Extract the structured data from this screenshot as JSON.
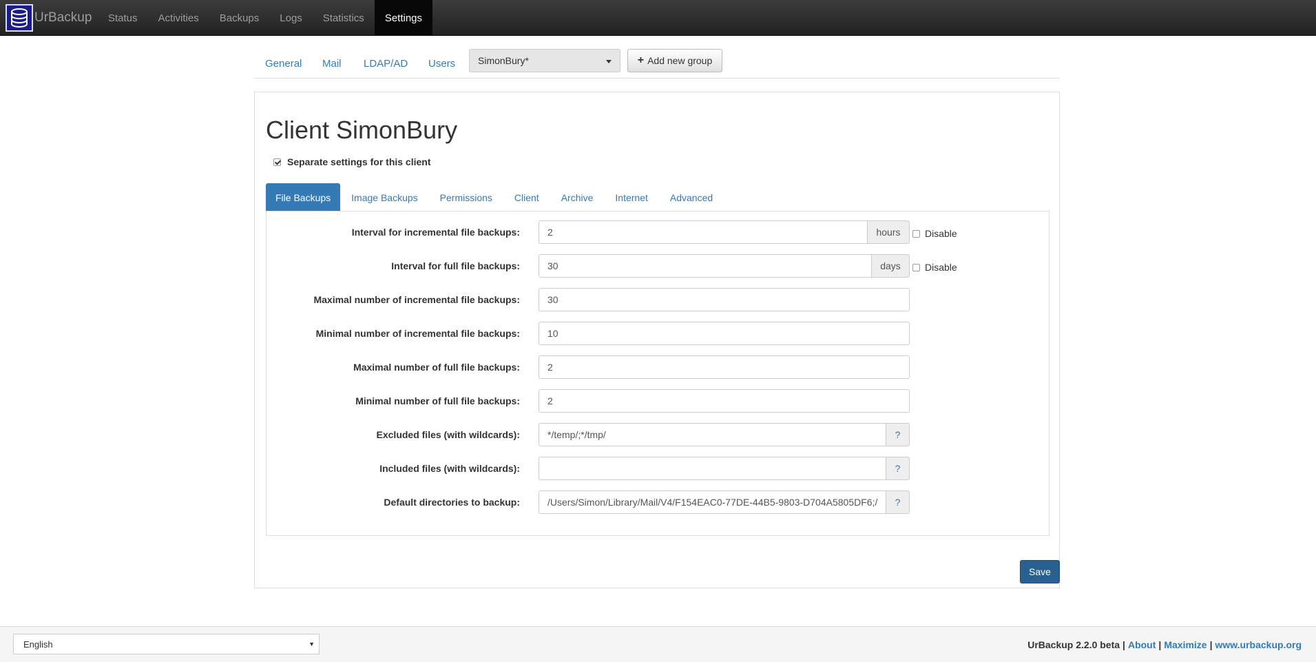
{
  "navbar": {
    "brand": "UrBackup",
    "items": [
      {
        "label": "Status",
        "active": false
      },
      {
        "label": "Activities",
        "active": false
      },
      {
        "label": "Backups",
        "active": false
      },
      {
        "label": "Logs",
        "active": false
      },
      {
        "label": "Statistics",
        "active": false
      },
      {
        "label": "Settings",
        "active": true
      }
    ]
  },
  "subnav": {
    "links": [
      "General",
      "Mail",
      "LDAP/AD",
      "Users"
    ],
    "group_select": "SimonBury*",
    "add_group": "Add new group"
  },
  "client": {
    "title": "Client SimonBury",
    "separate_settings_label": "Separate settings for this client",
    "separate_settings_checked": true
  },
  "tabs": [
    {
      "label": "File Backups",
      "active": true
    },
    {
      "label": "Image Backups",
      "active": false
    },
    {
      "label": "Permissions",
      "active": false
    },
    {
      "label": "Client",
      "active": false
    },
    {
      "label": "Archive",
      "active": false
    },
    {
      "label": "Internet",
      "active": false
    },
    {
      "label": "Advanced",
      "active": false
    }
  ],
  "form": {
    "incr_interval": {
      "label": "Interval for incremental file backups:",
      "value": "2",
      "unit": "hours",
      "disable_label": "Disable",
      "disabled": false
    },
    "full_interval": {
      "label": "Interval for full file backups:",
      "value": "30",
      "unit": "days",
      "disable_label": "Disable",
      "disabled": false
    },
    "max_incr": {
      "label": "Maximal number of incremental file backups:",
      "value": "30"
    },
    "min_incr": {
      "label": "Minimal number of incremental file backups:",
      "value": "10"
    },
    "max_full": {
      "label": "Maximal number of full file backups:",
      "value": "2"
    },
    "min_full": {
      "label": "Minimal number of full file backups:",
      "value": "2"
    },
    "excluded": {
      "label": "Excluded files (with wildcards):",
      "value": "*/temp/;*/tmp/",
      "help": "?"
    },
    "included": {
      "label": "Included files (with wildcards):",
      "value": "",
      "help": "?"
    },
    "default_dirs": {
      "label": "Default directories to backup:",
      "value": "/Users/Simon/Library/Mail/V4/F154EAC0-77DE-44B5-9803-D704A5805DF6;/",
      "help": "?"
    }
  },
  "save_label": "Save",
  "footer": {
    "language": "English",
    "version": "UrBackup 2.2.0 beta",
    "links": [
      "About",
      "Maximize",
      "www.urbackup.org"
    ]
  },
  "colors": {
    "accent": "#337ab7",
    "navbar": "#222222",
    "save": "#286090"
  }
}
